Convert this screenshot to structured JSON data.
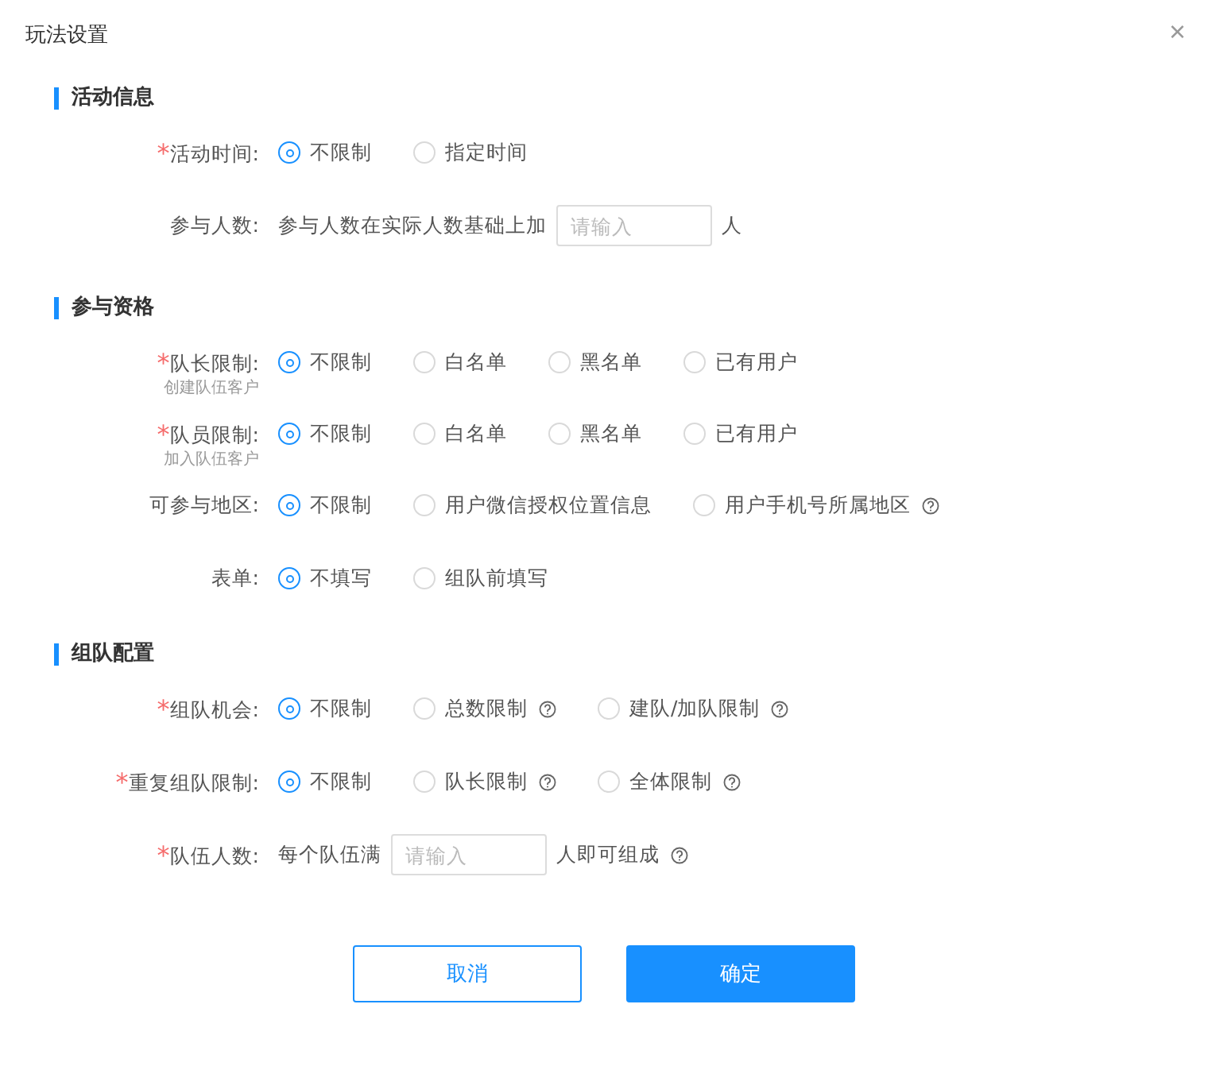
{
  "dialog": {
    "title": "玩法设置",
    "close": "×"
  },
  "sections": [
    {
      "title": "活动信息",
      "rows": [
        {
          "kind": "radio",
          "required_mark": "*",
          "label": "活动时间:",
          "options": [
            {
              "label": "不限制",
              "selected": true
            },
            {
              "label": "指定时间",
              "selected": false
            }
          ]
        },
        {
          "kind": "input",
          "label": "参与人数:",
          "prefix": "参与人数在实际人数基础上加",
          "placeholder": "请输入",
          "suffix": "人",
          "suffix_hint": false
        }
      ]
    },
    {
      "title": "参与资格",
      "rows": [
        {
          "kind": "radio",
          "required_mark": "*",
          "label": "队长限制:",
          "sublabel": "创建队伍客户",
          "options": [
            {
              "label": "不限制",
              "selected": true
            },
            {
              "label": "白名单",
              "selected": false
            },
            {
              "label": "黑名单",
              "selected": false
            },
            {
              "label": "已有用户",
              "selected": false
            }
          ]
        },
        {
          "kind": "radio",
          "required_mark": "*",
          "label": "队员限制:",
          "sublabel": "加入队伍客户",
          "options": [
            {
              "label": "不限制",
              "selected": true
            },
            {
              "label": "白名单",
              "selected": false
            },
            {
              "label": "黑名单",
              "selected": false
            },
            {
              "label": "已有用户",
              "selected": false
            }
          ]
        },
        {
          "kind": "radio",
          "label": "可参与地区:",
          "options": [
            {
              "label": "不限制",
              "selected": true
            },
            {
              "label": "用户微信授权位置信息",
              "selected": false
            },
            {
              "label": "用户手机号所属地区",
              "selected": false,
              "hint": true
            }
          ]
        },
        {
          "kind": "radio",
          "label": "表单:",
          "options": [
            {
              "label": "不填写",
              "selected": true
            },
            {
              "label": "组队前填写",
              "selected": false
            }
          ]
        }
      ]
    },
    {
      "title": "组队配置",
      "rows": [
        {
          "kind": "radio",
          "required_mark": "*",
          "label": "组队机会:",
          "options": [
            {
              "label": "不限制",
              "selected": true
            },
            {
              "label": "总数限制",
              "selected": false,
              "hint": true
            },
            {
              "label": "建队/加队限制",
              "selected": false,
              "hint": true
            }
          ]
        },
        {
          "kind": "radio",
          "required_mark": "*",
          "label": "重复组队限制:",
          "options": [
            {
              "label": "不限制",
              "selected": true
            },
            {
              "label": "队长限制",
              "selected": false,
              "hint": true
            },
            {
              "label": "全体限制",
              "selected": false,
              "hint": true
            }
          ]
        },
        {
          "kind": "input",
          "required_mark": "*",
          "label": "队伍人数:",
          "prefix": "每个队伍满",
          "placeholder": "请输入",
          "suffix": "人即可组成",
          "suffix_hint": true
        }
      ]
    }
  ],
  "buttons": [
    {
      "label": "取消",
      "kind": "secondary"
    },
    {
      "label": "确定",
      "kind": "primary"
    }
  ]
}
